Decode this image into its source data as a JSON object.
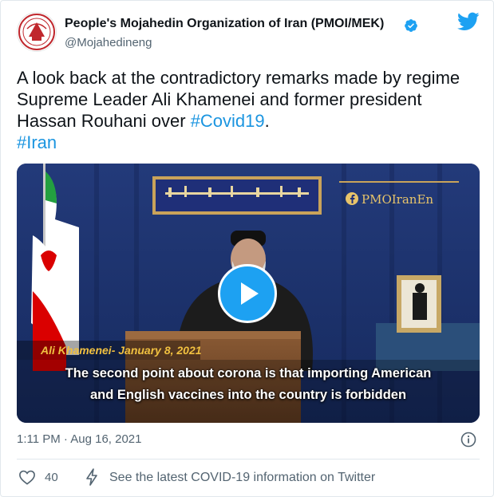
{
  "author": {
    "name": "People's Mojahedin Organization of Iran (PMOI/MEK)",
    "handle": "@Mojahedineng",
    "avatar_icon": "pmoi-logo-icon",
    "verified_icon": "verified-badge-icon"
  },
  "brand": {
    "twitter_icon": "twitter-bird-icon",
    "accent_color": "#1da1f2",
    "link_color": "#1b95e0"
  },
  "tweet": {
    "line1": "A look back at the contradictory remarks made by regime",
    "line2": "Supreme Leader Ali Khamenei and former president",
    "line3_text": "Hassan Rouhani over ",
    "line3_hashtag": "#Covid19",
    "line3_end": ".",
    "line4_hashtag": "#Iran"
  },
  "media": {
    "play_icon": "play-icon",
    "channel_label": "PMOIranEn",
    "caption_name": "Ali Khamenei- January 8, 2021",
    "subtitle_line1": "The second point about corona is that importing American",
    "subtitle_line2": "and English vaccines into the country is forbidden"
  },
  "footer": {
    "timestamp": "1:11 PM · Aug 16, 2021",
    "info_icon": "info-icon",
    "like_icon": "heart-icon",
    "like_count": "40",
    "covid_icon": "lightning-bolt-icon",
    "covid_link": "See the latest COVID-19 information on Twitter"
  }
}
